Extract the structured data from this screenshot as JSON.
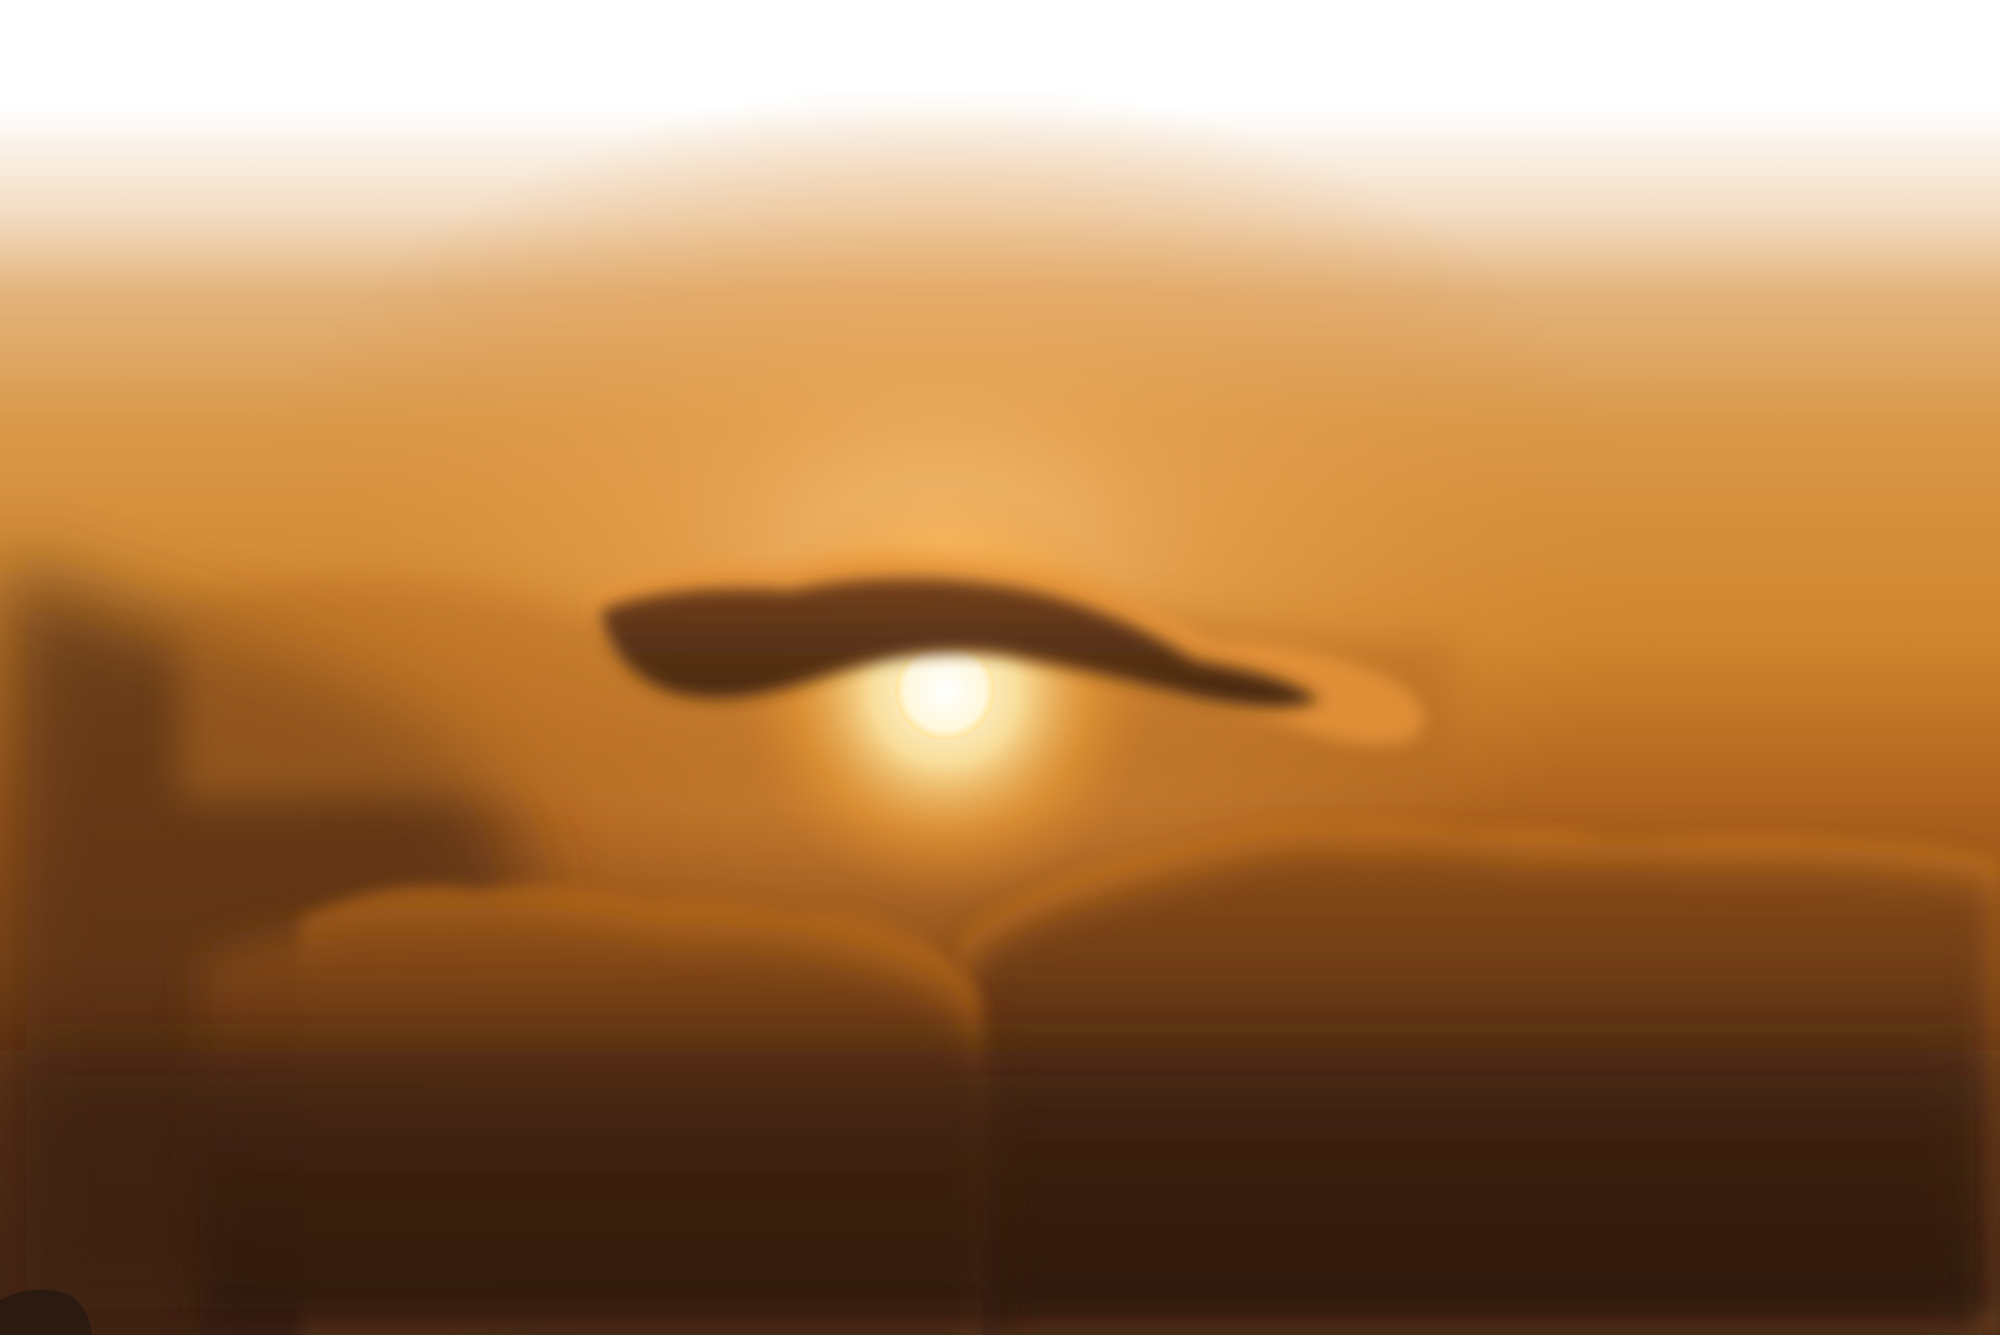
{
  "scene": {
    "subject": "sun-behind-clouds",
    "colors": {
      "top_fade": "#ffffff",
      "haze_light": "#f0b86e",
      "haze_mid": "#d98c3a",
      "sky_orange": "#c8731f",
      "cloud_dark": "#4a2a12",
      "cloud_mid": "#7a4618",
      "cloud_rim": "#e08a2a",
      "sun_core": "#fffbe6",
      "sun_glow": "#ffd27a",
      "bottom_dark": "#2e1a0c"
    }
  }
}
